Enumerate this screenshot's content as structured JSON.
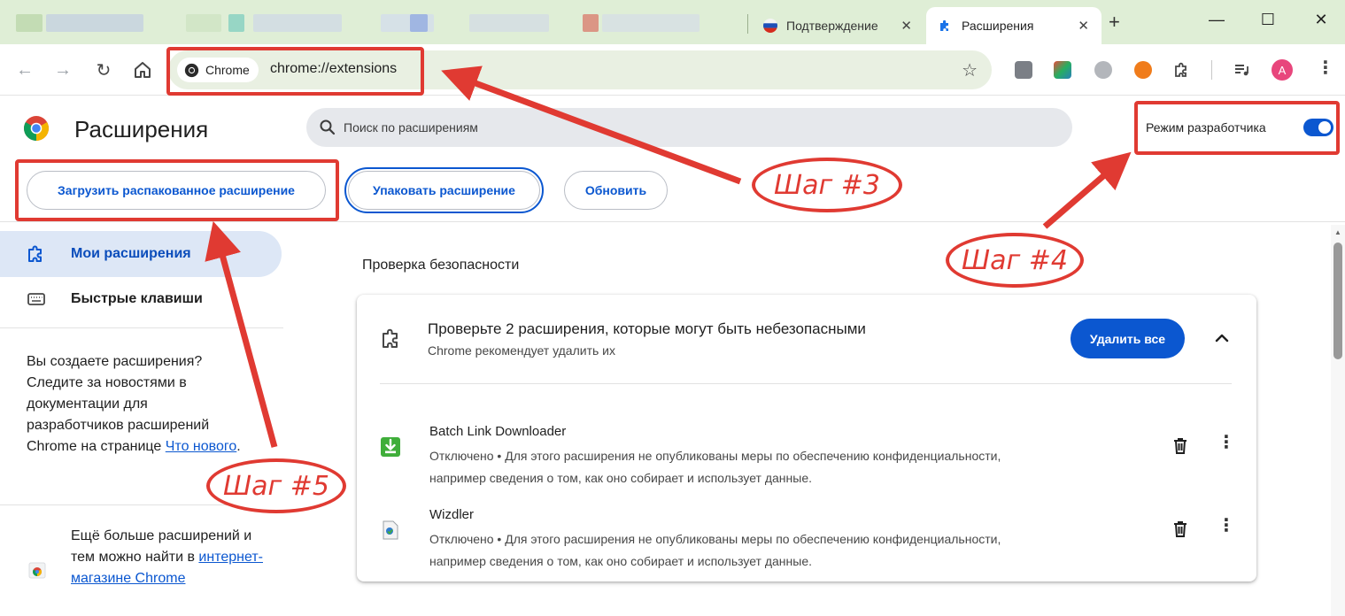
{
  "tabs": {
    "inactive_title": "Подтверждение",
    "active_title": "Расширения",
    "close_glyph": "✕",
    "new_tab_glyph": "+"
  },
  "window_controls": {
    "minimize": "—",
    "maximize": "☐",
    "close": "✕"
  },
  "toolbar": {
    "back_glyph": "←",
    "forward_glyph": "→",
    "reload_glyph": "↻",
    "chip_label": "Chrome",
    "url": "chrome://extensions",
    "star_glyph": "☆",
    "avatar_letter": "A",
    "menu_glyph": "⋮"
  },
  "header": {
    "title": "Расширения",
    "search_placeholder": "Поиск по расширениям",
    "dev_mode_label": "Режим разработчика",
    "dev_mode_on": true
  },
  "actions": {
    "load_unpacked": "Загрузить распакованное расширение",
    "pack": "Упаковать расширение",
    "update": "Обновить"
  },
  "sidebar": {
    "items": [
      {
        "label": "Мои расширения",
        "active": true
      },
      {
        "label": "Быстрые клавиши",
        "active": false
      }
    ],
    "dev_text_prefix": "Вы создаете расширения? Следите за новостями в документации для разработчиков расширений Chrome на странице ",
    "dev_link": "Что нового",
    "dev_text_suffix": ".",
    "store_text_prefix": "Ещё больше расширений и тем можно найти в ",
    "store_link": "интернет-магазине Chrome"
  },
  "safety": {
    "section_title": "Проверка безопасности",
    "card_title": "Проверьте 2 расширения, которые могут быть небезопасными",
    "card_subtitle": "Chrome рекомендует удалить их",
    "remove_all": "Удалить все",
    "extensions": [
      {
        "name": "Batch Link Downloader",
        "desc_line1": "Отключено • Для этого расширения не опубликованы меры по обеспечению конфиденциальности,",
        "desc_line2": "например сведения о том, как оно собирает и использует данные."
      },
      {
        "name": "Wizdler",
        "desc_line1": "Отключено • Для этого расширения не опубликованы меры по обеспечению конфиденциальности,",
        "desc_line2": "например сведения о том, как оно собирает и использует данные."
      }
    ]
  },
  "annotations": {
    "step3": "Шаг #3",
    "step4": "Шаг #4",
    "step5": "Шаг #5",
    "color": "#e03a32"
  },
  "colors": {
    "accent": "#0b57d0",
    "tabstrip": "#dfeed6",
    "sidebar_active": "#dde7f6"
  }
}
